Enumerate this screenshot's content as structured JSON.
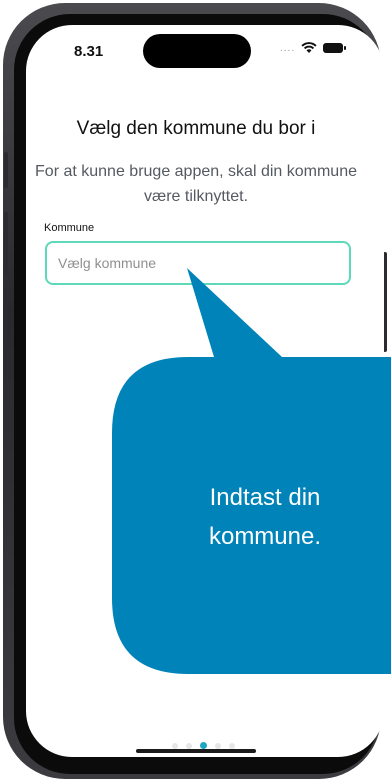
{
  "status_bar": {
    "time": "8.31",
    "signal": "....",
    "wifi_icon": "wifi-icon",
    "battery_icon": "battery-icon"
  },
  "screen": {
    "title": "Vælg den kommune du bor i",
    "subtitle": "For at kunne bruge appen, skal din kommune være tilknyttet.",
    "field_label": "Kommune",
    "field_placeholder": "Vælg kommune",
    "field_value": ""
  },
  "pager": {
    "pages": 5,
    "current": 3
  },
  "tooltip": {
    "text_line1": "Indtast din",
    "text_line2": "kommune.",
    "color": "#0083b8"
  },
  "colors": {
    "accent": "#5dd8b8",
    "active_dot": "#1fa7c2"
  }
}
